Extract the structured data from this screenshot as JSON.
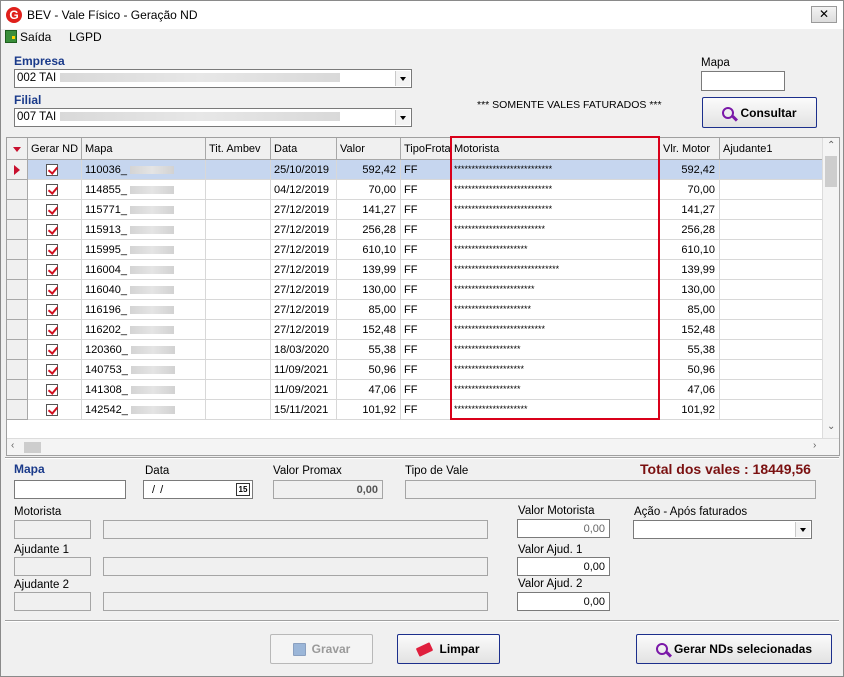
{
  "window": {
    "title": "BEV - Vale Físico - Geração ND",
    "close_label": "✕",
    "app_icon_letter": "G"
  },
  "menu": {
    "items": [
      "Saída",
      "LGPD"
    ]
  },
  "empresa": {
    "label": "Empresa",
    "value": "002 TAI"
  },
  "filial": {
    "label": "Filial",
    "value": "007 TAI"
  },
  "mapa_filter": {
    "label": "Mapa",
    "value": ""
  },
  "notice": "*** SOMENTE VALES FATURADOS ***",
  "consultar_label": "Consultar",
  "grid": {
    "columns": [
      "Gerar ND",
      "Mapa",
      "Tit. Ambev",
      "Data",
      "Valor",
      "TipoFrota",
      "Motorista",
      "Vlr. Motor",
      "Ajudante1"
    ],
    "rows": [
      {
        "mapa": "110036_",
        "tit": "",
        "data": "25/10/2019",
        "valor": "592,42",
        "tipo": "FF",
        "motorista": "****************************",
        "vlr_motor": "592,42"
      },
      {
        "mapa": "114855_",
        "tit": "",
        "data": "04/12/2019",
        "valor": "70,00",
        "tipo": "FF",
        "motorista": "****************************",
        "vlr_motor": "70,00"
      },
      {
        "mapa": "115771_",
        "tit": "",
        "data": "27/12/2019",
        "valor": "141,27",
        "tipo": "FF",
        "motorista": "****************************",
        "vlr_motor": "141,27"
      },
      {
        "mapa": "115913_",
        "tit": "",
        "data": "27/12/2019",
        "valor": "256,28",
        "tipo": "FF",
        "motorista": "**************************",
        "vlr_motor": "256,28"
      },
      {
        "mapa": "115995_",
        "tit": "",
        "data": "27/12/2019",
        "valor": "610,10",
        "tipo": "FF",
        "motorista": "*********************",
        "vlr_motor": "610,10"
      },
      {
        "mapa": "116004_",
        "tit": "",
        "data": "27/12/2019",
        "valor": "139,99",
        "tipo": "FF",
        "motorista": "******************************",
        "vlr_motor": "139,99"
      },
      {
        "mapa": "116040_",
        "tit": "",
        "data": "27/12/2019",
        "valor": "130,00",
        "tipo": "FF",
        "motorista": "***********************",
        "vlr_motor": "130,00"
      },
      {
        "mapa": "116196_",
        "tit": "",
        "data": "27/12/2019",
        "valor": "85,00",
        "tipo": "FF",
        "motorista": "**********************",
        "vlr_motor": "85,00"
      },
      {
        "mapa": "116202_",
        "tit": "",
        "data": "27/12/2019",
        "valor": "152,48",
        "tipo": "FF",
        "motorista": "**************************",
        "vlr_motor": "152,48"
      },
      {
        "mapa": "120360_",
        "tit": "",
        "data": "18/03/2020",
        "valor": "55,38",
        "tipo": "FF",
        "motorista": "*******************",
        "vlr_motor": "55,38"
      },
      {
        "mapa": "140753_",
        "tit": "",
        "data": "11/09/2021",
        "valor": "50,96",
        "tipo": "FF",
        "motorista": "********************",
        "vlr_motor": "50,96"
      },
      {
        "mapa": "141308_",
        "tit": "",
        "data": "11/09/2021",
        "valor": "47,06",
        "tipo": "FF",
        "motorista": "*******************",
        "vlr_motor": "47,06"
      },
      {
        "mapa": "142542_",
        "tit": "",
        "data": "15/11/2021",
        "valor": "101,92",
        "tipo": "FF",
        "motorista": "*********************",
        "vlr_motor": "101,92"
      }
    ]
  },
  "detail": {
    "mapa_label": "Mapa",
    "data_label": "Data",
    "data_value": "/ /",
    "calendar_day": "15",
    "valor_promax_label": "Valor Promax",
    "valor_promax_value": "0,00",
    "tipo_vale_label": "Tipo de Vale",
    "total_text": "Total dos vales : 18449,56",
    "motorista_label": "Motorista",
    "ajudante1_label": "Ajudante 1",
    "ajudante2_label": "Ajudante 2",
    "valor_motorista_label": "Valor Motorista",
    "valor_motorista_value": "0,00",
    "valor_ajud1_label": "Valor Ajud. 1",
    "valor_ajud1_value": "0,00",
    "valor_ajud2_label": "Valor Ajud. 2",
    "valor_ajud2_value": "0,00",
    "acao_label": "Ação - Após faturados"
  },
  "buttons": {
    "gravar": "Gravar",
    "limpar": "Limpar",
    "gerar": "Gerar NDs selecionadas"
  }
}
